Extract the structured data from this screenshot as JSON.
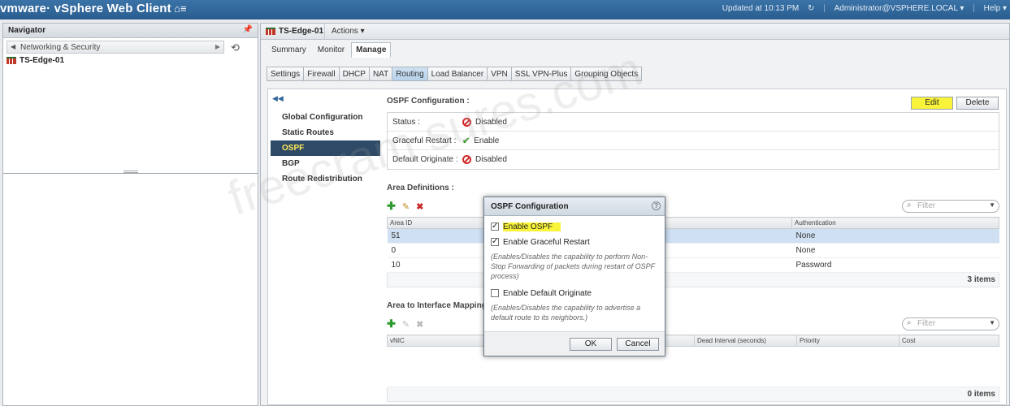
{
  "topbar": {
    "brand": "vmware· vSphere Web Client",
    "updated": "Updated at 10:13 PM",
    "user": "Administrator@VSPHERE.LOCAL ▾",
    "help": "Help ▾"
  },
  "navigator": {
    "title": "Navigator",
    "crumb": "Networking & Security",
    "tree_item": "TS-Edge-01"
  },
  "main": {
    "object_title": "TS-Edge-01",
    "actions": "Actions ▾",
    "tabs": [
      "Summary",
      "Monitor",
      "Manage"
    ],
    "subtabs": [
      "Settings",
      "Firewall",
      "DHCP",
      "NAT",
      "Routing",
      "Load Balancer",
      "VPN",
      "SSL VPN-Plus",
      "Grouping Objects"
    ],
    "menu": [
      "Global Configuration",
      "Static Routes",
      "OSPF",
      "BGP",
      "Route Redistribution"
    ]
  },
  "ospf": {
    "title": "OSPF Configuration :",
    "edit": "Edit",
    "delete": "Delete",
    "rows": [
      {
        "label": "Status :",
        "value": "Disabled",
        "icon": "disabled"
      },
      {
        "label": "Graceful Restart :",
        "value": "Enable",
        "icon": "check"
      },
      {
        "label": "Default Originate :",
        "value": "Disabled",
        "icon": "disabled"
      }
    ]
  },
  "area": {
    "title": "Area Definitions :",
    "filter_placeholder": "Filter",
    "columns": [
      "Area ID",
      "Authentication"
    ],
    "rows": [
      {
        "id": "51",
        "auth": "None"
      },
      {
        "id": "0",
        "auth": "None"
      },
      {
        "id": "10",
        "auth": "Password"
      }
    ],
    "count": "3 items"
  },
  "mapping": {
    "title": "Area to Interface Mapping :",
    "filter_placeholder": "Filter",
    "columns": [
      "vNIC",
      "",
      "",
      "Dead Interval (seconds)",
      "Priority",
      "Cost"
    ],
    "count": "0 items"
  },
  "dialog": {
    "title": "OSPF Configuration",
    "enable_ospf": "Enable OSPF",
    "enable_gr": "Enable Graceful Restart",
    "gr_hint": "(Enables/Disables the capability to perform Non-Stop Forwarding of packets during restart of OSPF process)",
    "enable_do": "Enable Default Originate",
    "do_hint": "(Enables/Disables the capability to advertise a default route to its neighbors.)",
    "ok": "OK",
    "cancel": "Cancel"
  },
  "watermark": "freecram sures.com"
}
